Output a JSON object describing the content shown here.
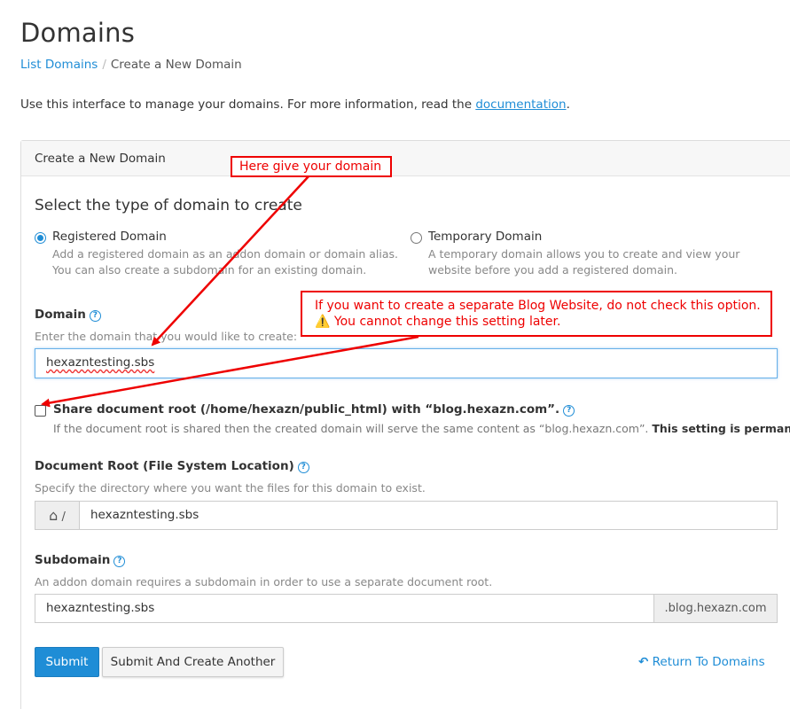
{
  "header": {
    "title": "Domains",
    "breadcrumb_link": "List Domains",
    "breadcrumb_sep": "/",
    "breadcrumb_current": "Create a New Domain"
  },
  "intro": {
    "text": "Use this interface to manage your domains. For more information, read the ",
    "link": "documentation",
    "end": "."
  },
  "panel": {
    "heading": "Create a New Domain",
    "section_title": "Select the type of domain to create"
  },
  "domain_types": {
    "registered": {
      "label": "Registered Domain",
      "desc1": "Add a registered domain as an addon domain or domain alias.",
      "desc2": "You can also create a subdomain for an existing domain.",
      "selected": true
    },
    "temporary": {
      "label": "Temporary Domain",
      "desc1": "A temporary domain allows you to create and view your",
      "desc2": "website before you add a registered domain.",
      "selected": false
    }
  },
  "domain": {
    "label": "Domain",
    "help": "Enter the domain that you would like to create:",
    "value": "hexazntesting.sbs"
  },
  "share_root": {
    "label": "Share document root (/home/hexazn/public_html) with “blog.hexazn.com”.",
    "desc": "If the document root is shared then the created domain will serve the same content as “blog.hexazn.com”. ",
    "desc_bold": "This setting is permanent.",
    "checked": false
  },
  "docroot": {
    "label": "Document Root (File System Location)",
    "help": "Specify the directory where you want the files for this domain to exist.",
    "prefix": "/",
    "value": "hexazntesting.sbs"
  },
  "subdomain": {
    "label": "Subdomain",
    "help": "An addon domain requires a subdomain in order to use a separate document root.",
    "value": "hexazntesting.sbs",
    "suffix": ".blog.hexazn.com"
  },
  "actions": {
    "submit": "Submit",
    "submit_another": "Submit And Create Another",
    "return": "Return To Domains"
  },
  "annotations": {
    "note1": "Here give your domain",
    "note2_line1": "If you want to create a separate Blog Website, do not check this option.",
    "note2_line2": "⚠️ You cannot change this setting later."
  },
  "colors": {
    "accent": "#1f8dd6",
    "annotation": "#e00000"
  },
  "icons": {
    "help": "?",
    "home": "⌂",
    "return": "↶"
  }
}
